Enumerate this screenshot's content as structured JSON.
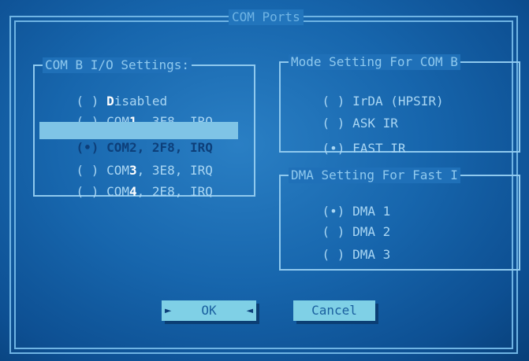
{
  "dialog": {
    "title": "COM Ports"
  },
  "com_io": {
    "title": "COM B I/O Settings:",
    "options": [
      {
        "prefix": "( ) ",
        "hot": "D",
        "rest": "isabled",
        "selected": false
      },
      {
        "prefix": "( ) COM",
        "hot": "1",
        "rest": ", 3F8, IRQ",
        "selected": false
      },
      {
        "prefix": "(•) COM",
        "hot": "2",
        "rest": ", 2F8, IRQ",
        "selected": true
      },
      {
        "prefix": "( ) COM",
        "hot": "3",
        "rest": ", 3E8, IRQ",
        "selected": false
      },
      {
        "prefix": "( ) COM",
        "hot": "4",
        "rest": ", 2E8, IRQ",
        "selected": false
      }
    ]
  },
  "mode": {
    "title": "Mode Setting For COM B",
    "options": [
      {
        "label": "( ) IrDA (HPSIR)",
        "selected": false
      },
      {
        "label": "( ) ASK IR",
        "selected": false
      },
      {
        "label": "(•) FAST IR",
        "selected": true
      }
    ]
  },
  "dma": {
    "title": "DMA Setting For Fast I",
    "options": [
      {
        "label": "(•) DMA 1",
        "selected": true
      },
      {
        "label": "( ) DMA 2",
        "selected": false
      },
      {
        "label": "( ) DMA 3",
        "selected": false
      }
    ]
  },
  "buttons": {
    "ok": "OK",
    "cancel": "Cancel"
  }
}
